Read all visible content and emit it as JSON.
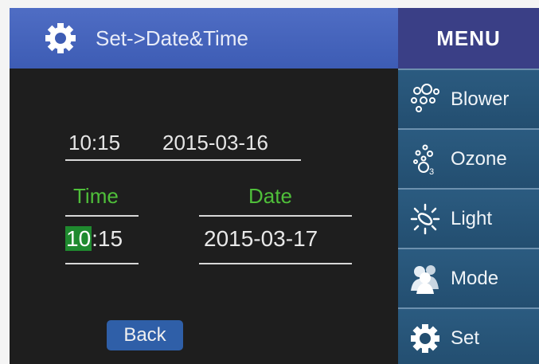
{
  "header": {
    "title": "Set->Date&Time",
    "icon": "gear-icon"
  },
  "menu": {
    "title": "MENU",
    "items": [
      {
        "label": "Blower",
        "icon": "blower-icon"
      },
      {
        "label": "Ozone",
        "icon": "ozone-icon"
      },
      {
        "label": "Light",
        "icon": "light-icon"
      },
      {
        "label": "Mode",
        "icon": "mode-icon"
      },
      {
        "label": "Set",
        "icon": "gear-icon"
      }
    ]
  },
  "current": {
    "time": "10:15",
    "date": "2015-03-16"
  },
  "editor": {
    "time_label": "Time",
    "date_label": "Date",
    "time_hour": "10",
    "time_rest": ":15",
    "date_value": "2015-03-17"
  },
  "back_label": "Back",
  "colors": {
    "header": "#4a68c0",
    "menu_header": "#3a3f86",
    "sidebar": "#27506f",
    "label_green": "#4fbf3a",
    "highlight": "#1f8a2f",
    "back_button": "#2f5fa8"
  }
}
